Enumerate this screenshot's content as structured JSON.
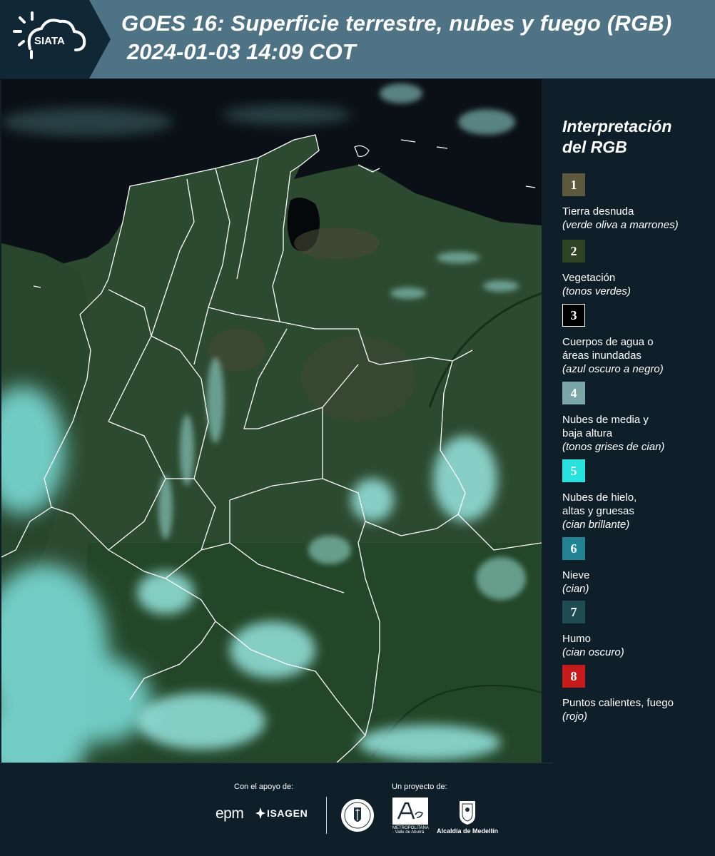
{
  "header": {
    "logo_text": "SIATA",
    "title": "GOES 16: Superficie terrestre, nubes y fuego (RGB)",
    "subtitle": "2024-01-03 14:09 COT"
  },
  "legend": {
    "title_line1": "Interpretación",
    "title_line2": "del RGB",
    "items": [
      {
        "number": "1",
        "label": "Tierra desnuda",
        "desc": "(verde oliva a marrones)",
        "color": "#5d5a3e",
        "border": "#5d5a3e"
      },
      {
        "number": "2",
        "label": "Vegetación",
        "desc": "(tonos verdes)",
        "color": "#2e4423",
        "border": "#2e4423"
      },
      {
        "number": "3",
        "label": "Cuerpos de agua o",
        "label2": "áreas inundadas",
        "desc": "(azul oscuro a negro)",
        "color": "#000000",
        "border": "#ffffff"
      },
      {
        "number": "4",
        "label": "Nubes de media y",
        "label2": "baja altura",
        "desc": "(tonos grises de cian)",
        "color": "#7aa6a7",
        "border": "#7aa6a7"
      },
      {
        "number": "5",
        "label": "Nubes de hielo,",
        "label2": "altas y gruesas",
        "desc": "(cian brillante)",
        "color": "#26e3df",
        "border": "#26e3df"
      },
      {
        "number": "6",
        "label": "Nieve",
        "desc": "(cian)",
        "color": "#1f8394",
        "border": "#1f8394"
      },
      {
        "number": "7",
        "label": "Humo",
        "desc": "(cian oscuro)",
        "color": "#1e4c50",
        "border": "#1e4c50"
      },
      {
        "number": "8",
        "label": "Puntos calientes, fuego",
        "desc": "(rojo)",
        "color": "#c61b1b",
        "border": "#c61b1b"
      }
    ]
  },
  "footer": {
    "support_label": "Con el apoyo de:",
    "project_label": "Un proyecto de:",
    "epm": "epm",
    "isagen": "ISAGEN",
    "area_sub": "METROPOLITANA · Valle de Aburrá",
    "alcaldia": "Alcaldía de Medellín"
  },
  "colors": {
    "header_bg": "#4d7385",
    "panel_bg": "#0e1f2a",
    "land": "#2c4a30",
    "cloud": "#8fe6e4",
    "water": "#0a0f14"
  }
}
